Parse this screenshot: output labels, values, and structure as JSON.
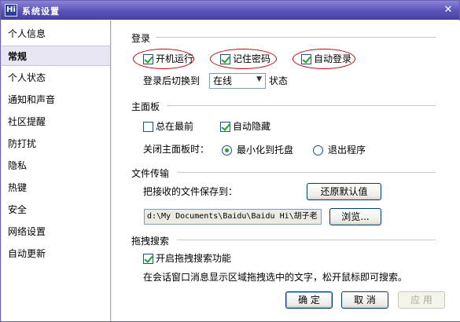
{
  "window": {
    "app_icon": "Hi",
    "title": "系统设置",
    "close_glyph": "✕"
  },
  "sidebar": {
    "items": [
      {
        "label": "个人信息",
        "active": false
      },
      {
        "label": "常规",
        "active": true
      },
      {
        "label": "个人状态",
        "active": false
      },
      {
        "label": "通知和声音",
        "active": false
      },
      {
        "label": "社区提醒",
        "active": false
      },
      {
        "label": "防打扰",
        "active": false
      },
      {
        "label": "隐私",
        "active": false
      },
      {
        "label": "热键",
        "active": false
      },
      {
        "label": "安全",
        "active": false
      },
      {
        "label": "网络设置",
        "active": false
      },
      {
        "label": "自动更新",
        "active": false
      }
    ]
  },
  "login": {
    "title": "登录",
    "auto_start_label": "开机运行",
    "auto_start_checked": true,
    "remember_pwd_label": "记住密码",
    "remember_pwd_checked": true,
    "auto_login_label": "自动登录",
    "auto_login_checked": true,
    "switch_label": "登录后切换到",
    "status_value": "在线",
    "status_suffix": "状态",
    "highlight_color": "#c40000"
  },
  "main_panel": {
    "title": "主面板",
    "always_top_label": "总在最前",
    "always_top_checked": false,
    "auto_hide_label": "自动隐藏",
    "auto_hide_checked": true,
    "close_label": "关闭主面板时：",
    "minimize_label": "最小化到托盘",
    "minimize_selected": true,
    "exit_label": "退出程序",
    "exit_selected": false
  },
  "file_transfer": {
    "title": "文件传输",
    "save_label": "把接收的文件保存到：",
    "restore_button": "还原默认值",
    "path_value": "d:\\My Documents\\Baidu\\Baidu Hi\\胡子老",
    "browse_button": "浏览..."
  },
  "drag_search": {
    "title": "拖拽搜索",
    "enable_label": "开启拖拽搜索功能",
    "enable_checked": true,
    "description": "在会话窗口消息显示区域拖拽选中的文字，松开鼠标即可搜索。"
  },
  "footer": {
    "ok": "确 定",
    "cancel": "取 消",
    "apply": "应 用"
  }
}
